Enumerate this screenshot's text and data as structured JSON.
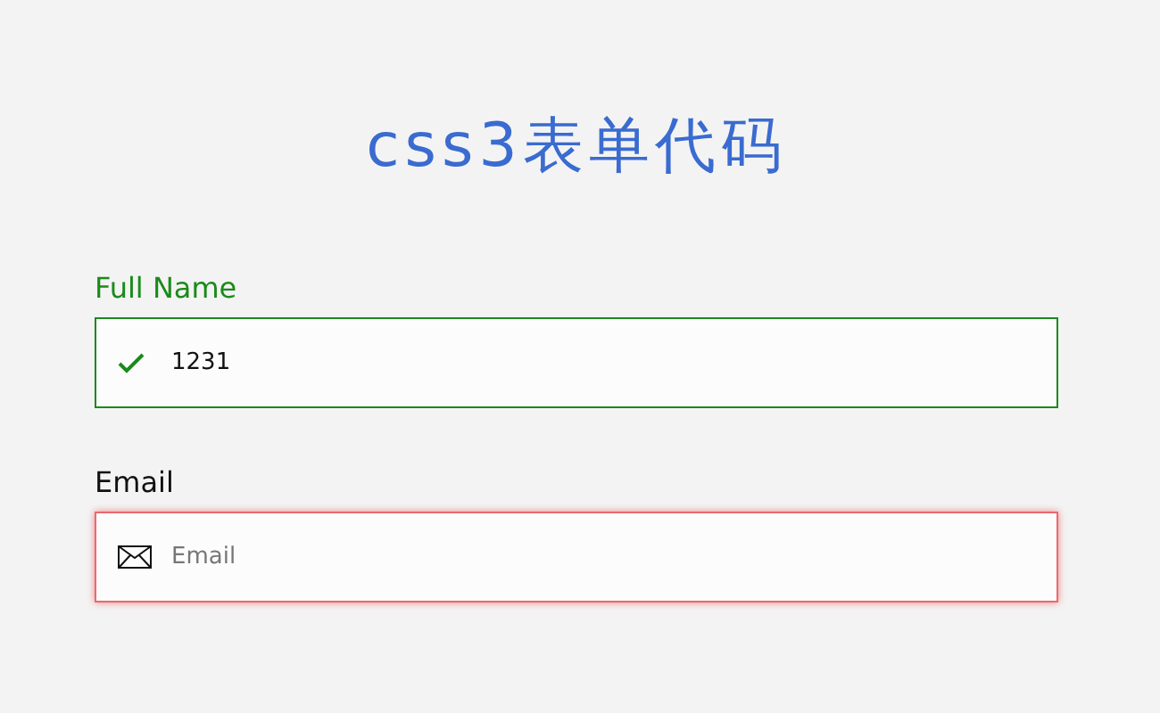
{
  "title": "css3表单代码",
  "fields": [
    {
      "label": "Full Name",
      "kind": "text",
      "valid": true,
      "value": "1231"
    },
    {
      "label": "Email",
      "kind": "email",
      "valid": false,
      "placeholder": "Email"
    }
  ]
}
